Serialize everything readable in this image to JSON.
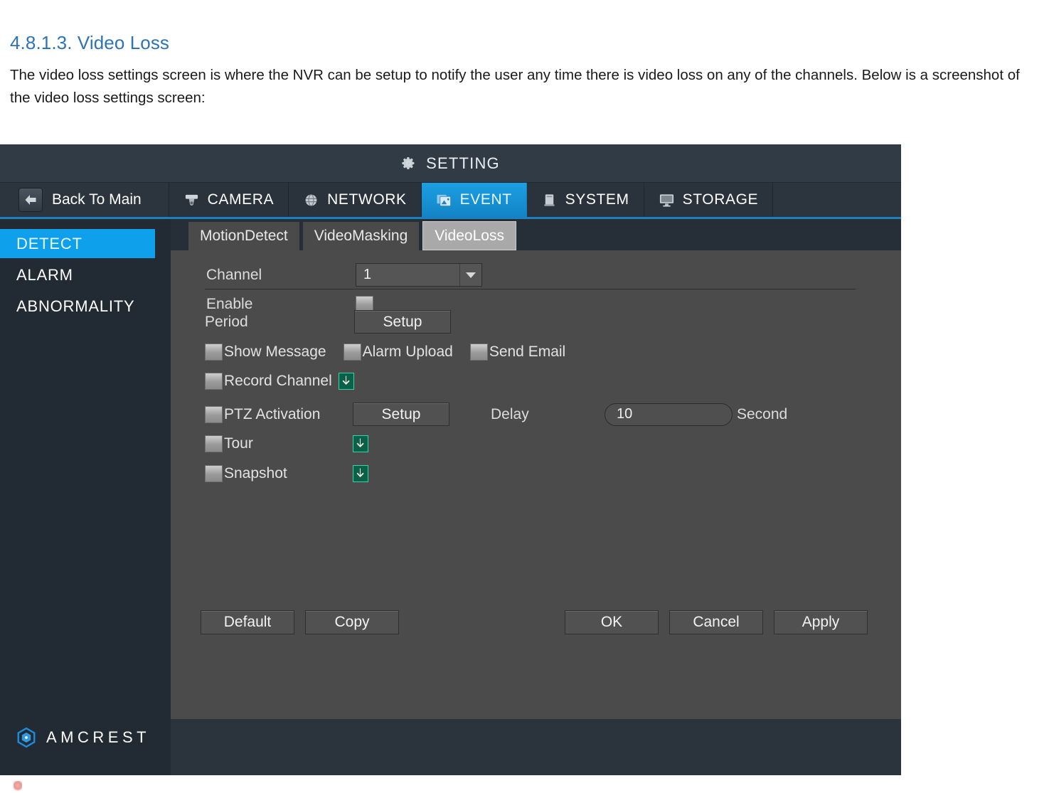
{
  "document": {
    "heading": "4.8.1.3. Video Loss",
    "paragraph": "The video loss settings screen is where the NVR can be setup to notify the user any time there is video loss on any of the channels. Below is a screenshot of the video loss settings screen:"
  },
  "nvr": {
    "titlebar": {
      "title": "SETTING",
      "icon": "gear-icon"
    },
    "menubar": {
      "back": {
        "label": "Back To Main",
        "icon": "back-arrow-icon"
      },
      "tabs": [
        {
          "label": "CAMERA",
          "icon": "camera-icon",
          "active": false
        },
        {
          "label": "NETWORK",
          "icon": "globe-icon",
          "active": false
        },
        {
          "label": "EVENT",
          "icon": "event-icon",
          "active": true
        },
        {
          "label": "SYSTEM",
          "icon": "system-icon",
          "active": false
        },
        {
          "label": "STORAGE",
          "icon": "monitor-icon",
          "active": false
        }
      ]
    },
    "sidebar": {
      "items": [
        {
          "label": "DETECT",
          "active": true
        },
        {
          "label": "ALARM",
          "active": false
        },
        {
          "label": "ABNORMALITY",
          "active": false
        }
      ],
      "brand": "AMCREST"
    },
    "subtabs": [
      {
        "label": "MotionDetect",
        "active": false
      },
      {
        "label": "VideoMasking",
        "active": false
      },
      {
        "label": "VideoLoss",
        "active": true
      }
    ],
    "form": {
      "channel_label": "Channel",
      "channel_value": "1",
      "channel_options": [
        "1"
      ],
      "enable_label": "Enable",
      "enable_checked": false,
      "period_label": "Period",
      "period_setup_label": "Setup",
      "show_message_label": "Show Message",
      "alarm_upload_label": "Alarm Upload",
      "send_email_label": "Send Email",
      "record_channel_label": "Record Channel",
      "ptz_activation_label": "PTZ Activation",
      "ptz_setup_label": "Setup",
      "delay_label": "Delay",
      "delay_value": "10",
      "delay_unit": "Second",
      "tour_label": "Tour",
      "snapshot_label": "Snapshot",
      "expand_icon": "green-down-arrow-icon"
    },
    "buttons": {
      "default": "Default",
      "copy": "Copy",
      "ok": "OK",
      "cancel": "Cancel",
      "apply": "Apply"
    },
    "colors": {
      "accent_blue": "#0fa0ec",
      "tab_active_blue": "#1c9fe3",
      "panel_gray": "#4b4b4b",
      "chrome_dark": "#2b343d",
      "rule_blue": "#1c7fc0",
      "arrow_green": "#0d6b52"
    }
  }
}
